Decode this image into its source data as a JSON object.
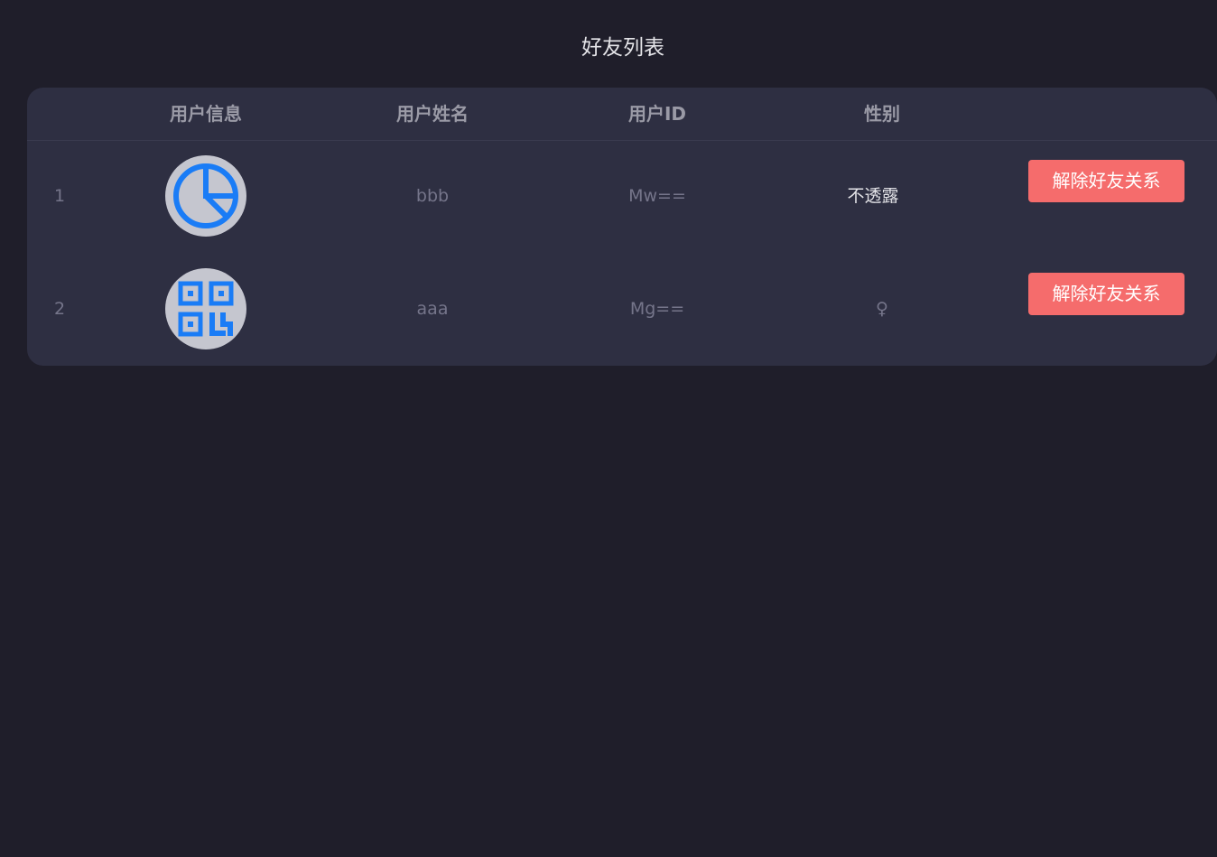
{
  "page": {
    "title": "好友列表"
  },
  "table": {
    "headers": {
      "index": "",
      "user_info": "用户信息",
      "user_name": "用户姓名",
      "user_id": "用户ID",
      "gender": "性别",
      "action": ""
    },
    "rows": [
      {
        "index": "1",
        "avatar_icon": "pie-chart-icon",
        "user_name": "bbb",
        "user_id": "Mw==",
        "gender": "不透露",
        "action_label": "解除好友关系"
      },
      {
        "index": "2",
        "avatar_icon": "qr-code-icon",
        "user_name": "aaa",
        "user_id": "Mg==",
        "gender": "♀",
        "action_label": "解除好友关系"
      }
    ]
  },
  "colors": {
    "background": "#1f1e2a",
    "card": "#2e2f42",
    "danger_button": "#f56c6c",
    "icon_blue": "#1a7cf6",
    "avatar_bg": "#c5c6cf"
  }
}
